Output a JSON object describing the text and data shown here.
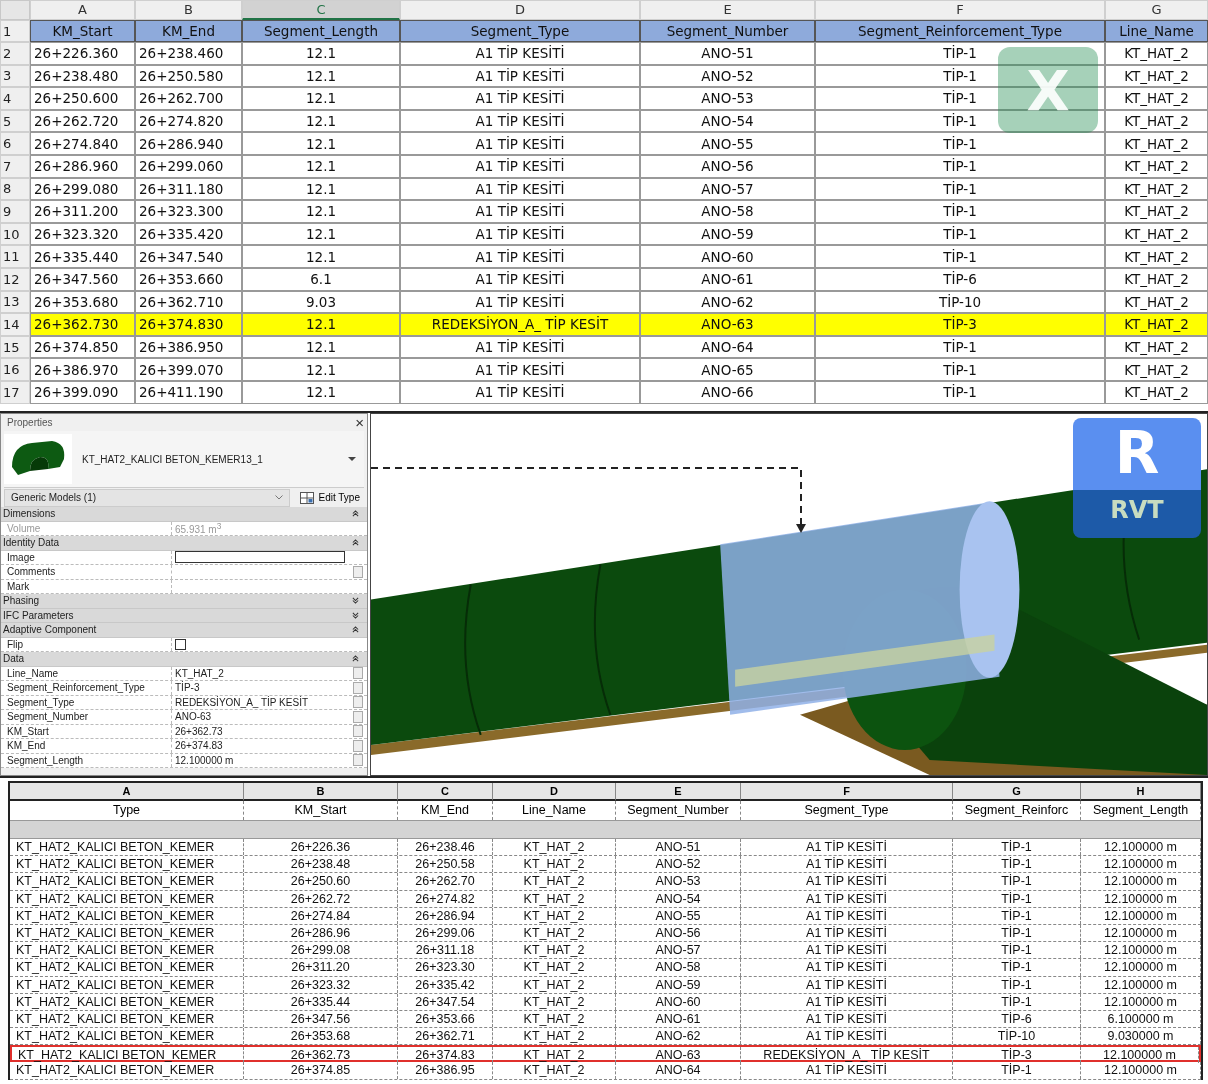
{
  "spreadsheet": {
    "columns": [
      {
        "letter": "A",
        "selected": false
      },
      {
        "letter": "B",
        "selected": false
      },
      {
        "letter": "C",
        "selected": true
      },
      {
        "letter": "D",
        "selected": false
      },
      {
        "letter": "E",
        "selected": false
      },
      {
        "letter": "F",
        "selected": false
      },
      {
        "letter": "G",
        "selected": false
      }
    ],
    "header_row": {
      "num": "1",
      "cells": [
        "KM_Start",
        "KM_End",
        "Segment_Length",
        "Segment_Type",
        "Segment_Number",
        "Segment_Reinforcement_Type",
        "Line_Name"
      ]
    },
    "rows": [
      {
        "num": "2",
        "highlighted": false,
        "cells": [
          "26+226.360",
          "26+238.460",
          "12.1",
          "A1 TİP KESİTİ",
          "ANO-51",
          "TİP-1",
          "KT_HAT_2"
        ]
      },
      {
        "num": "3",
        "highlighted": false,
        "cells": [
          "26+238.480",
          "26+250.580",
          "12.1",
          "A1 TİP KESİTİ",
          "ANO-52",
          "TİP-1",
          "KT_HAT_2"
        ]
      },
      {
        "num": "4",
        "highlighted": false,
        "cells": [
          "26+250.600",
          "26+262.700",
          "12.1",
          "A1 TİP KESİTİ",
          "ANO-53",
          "TİP-1",
          "KT_HAT_2"
        ]
      },
      {
        "num": "5",
        "highlighted": false,
        "cells": [
          "26+262.720",
          "26+274.820",
          "12.1",
          "A1 TİP KESİTİ",
          "ANO-54",
          "TİP-1",
          "KT_HAT_2"
        ]
      },
      {
        "num": "6",
        "highlighted": false,
        "cells": [
          "26+274.840",
          "26+286.940",
          "12.1",
          "A1 TİP KESİTİ",
          "ANO-55",
          "TİP-1",
          "KT_HAT_2"
        ]
      },
      {
        "num": "7",
        "highlighted": false,
        "cells": [
          "26+286.960",
          "26+299.060",
          "12.1",
          "A1 TİP KESİTİ",
          "ANO-56",
          "TİP-1",
          "KT_HAT_2"
        ]
      },
      {
        "num": "8",
        "highlighted": false,
        "cells": [
          "26+299.080",
          "26+311.180",
          "12.1",
          "A1 TİP KESİTİ",
          "ANO-57",
          "TİP-1",
          "KT_HAT_2"
        ]
      },
      {
        "num": "9",
        "highlighted": false,
        "cells": [
          "26+311.200",
          "26+323.300",
          "12.1",
          "A1 TİP KESİTİ",
          "ANO-58",
          "TİP-1",
          "KT_HAT_2"
        ]
      },
      {
        "num": "10",
        "highlighted": false,
        "cells": [
          "26+323.320",
          "26+335.420",
          "12.1",
          "A1 TİP KESİTİ",
          "ANO-59",
          "TİP-1",
          "KT_HAT_2"
        ]
      },
      {
        "num": "11",
        "highlighted": false,
        "cells": [
          "26+335.440",
          "26+347.540",
          "12.1",
          "A1 TİP KESİTİ",
          "ANO-60",
          "TİP-1",
          "KT_HAT_2"
        ]
      },
      {
        "num": "12",
        "highlighted": false,
        "cells": [
          "26+347.560",
          "26+353.660",
          "6.1",
          "A1 TİP KESİTİ",
          "ANO-61",
          "TİP-6",
          "KT_HAT_2"
        ]
      },
      {
        "num": "13",
        "highlighted": false,
        "cells": [
          "26+353.680",
          "26+362.710",
          "9.03",
          "A1 TİP KESİTİ",
          "ANO-62",
          "TİP-10",
          "KT_HAT_2"
        ]
      },
      {
        "num": "14",
        "highlighted": true,
        "cells": [
          "26+362.730",
          "26+374.830",
          "12.1",
          "REDEKSİYON_A_ TİP KESİT",
          "ANO-63",
          "TİP-3",
          "KT_HAT_2"
        ]
      },
      {
        "num": "15",
        "highlighted": false,
        "cells": [
          "26+374.850",
          "26+386.950",
          "12.1",
          "A1 TİP KESİTİ",
          "ANO-64",
          "TİP-1",
          "KT_HAT_2"
        ]
      },
      {
        "num": "16",
        "highlighted": false,
        "cells": [
          "26+386.970",
          "26+399.070",
          "12.1",
          "A1 TİP KESİTİ",
          "ANO-65",
          "TİP-1",
          "KT_HAT_2"
        ]
      },
      {
        "num": "17",
        "highlighted": false,
        "cells": [
          "26+399.090",
          "26+411.190",
          "12.1",
          "A1 TİP KESİTİ",
          "ANO-66",
          "TİP-1",
          "KT_HAT_2"
        ]
      }
    ],
    "logo": "X"
  },
  "properties": {
    "title": "Properties",
    "close": "×",
    "type_name": "KT_HAT2_KALICI BETON_KEMER13_1",
    "category": "Generic Models (1)",
    "edit_type": "Edit Type",
    "groups": [
      {
        "name": "Dimensions",
        "expanded": true,
        "rows": [
          {
            "label": "Volume",
            "value": "65.931 m$^{3}$",
            "kind": "text",
            "disabled": true,
            "has_button": false
          }
        ]
      },
      {
        "name": "Identity Data",
        "expanded": true,
        "rows": [
          {
            "label": "Image",
            "kind": "input",
            "disabled": false,
            "has_button": false
          },
          {
            "label": "Comments",
            "kind": "text",
            "disabled": false,
            "has_button": true
          },
          {
            "label": "Mark",
            "kind": "text",
            "disabled": false,
            "has_button": false
          }
        ]
      },
      {
        "name": "Phasing",
        "expanded": false
      },
      {
        "name": "IFC Parameters",
        "expanded": false
      },
      {
        "name": "Adaptive Component",
        "expanded": true,
        "rows": [
          {
            "label": "Flip",
            "kind": "checkbox",
            "checked": false,
            "disabled": false,
            "has_button": false
          }
        ]
      },
      {
        "name": "Data",
        "expanded": true,
        "rows": [
          {
            "label": "Line_Name",
            "value": "KT_HAT_2",
            "kind": "text",
            "disabled": false,
            "has_button": true
          },
          {
            "label": "Segment_Reinforcement_Type",
            "value": "TİP-3",
            "kind": "text",
            "disabled": false,
            "has_button": true
          },
          {
            "label": "Segment_Type",
            "value": "REDEKSİYON_A_ TİP KESİT",
            "kind": "text",
            "disabled": false,
            "has_button": true
          },
          {
            "label": "Segment_Number",
            "value": "ANO-63",
            "kind": "text",
            "disabled": false,
            "has_button": true
          },
          {
            "label": "KM_Start",
            "value": "26+362.73",
            "kind": "text",
            "disabled": false,
            "has_button": true
          },
          {
            "label": "KM_End",
            "value": "26+374.83",
            "kind": "text",
            "disabled": false,
            "has_button": true
          },
          {
            "label": "Segment_Length",
            "value": "12.100000 m",
            "kind": "text",
            "disabled": false,
            "has_button": true
          }
        ]
      }
    ]
  },
  "viewport": {
    "logo_letter": "R",
    "logo_label": "RVT"
  },
  "schedule": {
    "column_letters": [
      "A",
      "B",
      "C",
      "D",
      "E",
      "F",
      "G",
      "H"
    ],
    "headers": [
      "Type",
      "KM_Start",
      "KM_End",
      "Line_Name",
      "Segment_Number",
      "Segment_Type",
      "Segment_Reinforc",
      "Segment_Length"
    ],
    "rows": [
      {
        "highlighted": false,
        "cells": [
          "KT_HAT2_KALICI BETON_KEMER",
          "26+226.36",
          "26+238.46",
          "KT_HAT_2",
          "ANO-51",
          "A1 TİP KESİTİ",
          "TİP-1",
          "12.100000 m"
        ]
      },
      {
        "highlighted": false,
        "cells": [
          "KT_HAT2_KALICI BETON_KEMER",
          "26+238.48",
          "26+250.58",
          "KT_HAT_2",
          "ANO-52",
          "A1 TİP KESİTİ",
          "TİP-1",
          "12.100000 m"
        ]
      },
      {
        "highlighted": false,
        "cells": [
          "KT_HAT2_KALICI BETON_KEMER",
          "26+250.60",
          "26+262.70",
          "KT_HAT_2",
          "ANO-53",
          "A1 TİP KESİTİ",
          "TİP-1",
          "12.100000 m"
        ]
      },
      {
        "highlighted": false,
        "cells": [
          "KT_HAT2_KALICI BETON_KEMER",
          "26+262.72",
          "26+274.82",
          "KT_HAT_2",
          "ANO-54",
          "A1 TİP KESİTİ",
          "TİP-1",
          "12.100000 m"
        ]
      },
      {
        "highlighted": false,
        "cells": [
          "KT_HAT2_KALICI BETON_KEMER",
          "26+274.84",
          "26+286.94",
          "KT_HAT_2",
          "ANO-55",
          "A1 TİP KESİTİ",
          "TİP-1",
          "12.100000 m"
        ]
      },
      {
        "highlighted": false,
        "cells": [
          "KT_HAT2_KALICI BETON_KEMER",
          "26+286.96",
          "26+299.06",
          "KT_HAT_2",
          "ANO-56",
          "A1 TİP KESİTİ",
          "TİP-1",
          "12.100000 m"
        ]
      },
      {
        "highlighted": false,
        "cells": [
          "KT_HAT2_KALICI BETON_KEMER",
          "26+299.08",
          "26+311.18",
          "KT_HAT_2",
          "ANO-57",
          "A1 TİP KESİTİ",
          "TİP-1",
          "12.100000 m"
        ]
      },
      {
        "highlighted": false,
        "cells": [
          "KT_HAT2_KALICI BETON_KEMER",
          "26+311.20",
          "26+323.30",
          "KT_HAT_2",
          "ANO-58",
          "A1 TİP KESİTİ",
          "TİP-1",
          "12.100000 m"
        ]
      },
      {
        "highlighted": false,
        "cells": [
          "KT_HAT2_KALICI BETON_KEMER",
          "26+323.32",
          "26+335.42",
          "KT_HAT_2",
          "ANO-59",
          "A1 TİP KESİTİ",
          "TİP-1",
          "12.100000 m"
        ]
      },
      {
        "highlighted": false,
        "cells": [
          "KT_HAT2_KALICI BETON_KEMER",
          "26+335.44",
          "26+347.54",
          "KT_HAT_2",
          "ANO-60",
          "A1 TİP KESİTİ",
          "TİP-1",
          "12.100000 m"
        ]
      },
      {
        "highlighted": false,
        "cells": [
          "KT_HAT2_KALICI BETON_KEMER",
          "26+347.56",
          "26+353.66",
          "KT_HAT_2",
          "ANO-61",
          "A1 TİP KESİTİ",
          "TİP-6",
          "6.100000 m"
        ]
      },
      {
        "highlighted": false,
        "cells": [
          "KT_HAT2_KALICI BETON_KEMER",
          "26+353.68",
          "26+362.71",
          "KT_HAT_2",
          "ANO-62",
          "A1 TİP KESİTİ",
          "TİP-10",
          "9.030000 m"
        ]
      },
      {
        "highlighted": true,
        "cells": [
          "KT_HAT2_KALICI BETON_KEMER",
          "26+362.73",
          "26+374.83",
          "KT_HAT_2",
          "ANO-63",
          "REDEKSİYON_A_ TİP KESİT",
          "TİP-3",
          "12.100000 m"
        ]
      },
      {
        "highlighted": false,
        "cells": [
          "KT_HAT2_KALICI BETON_KEMER",
          "26+374.85",
          "26+386.95",
          "KT_HAT_2",
          "ANO-64",
          "A1 TİP KESİTİ",
          "TİP-1",
          "12.100000 m"
        ]
      }
    ]
  }
}
